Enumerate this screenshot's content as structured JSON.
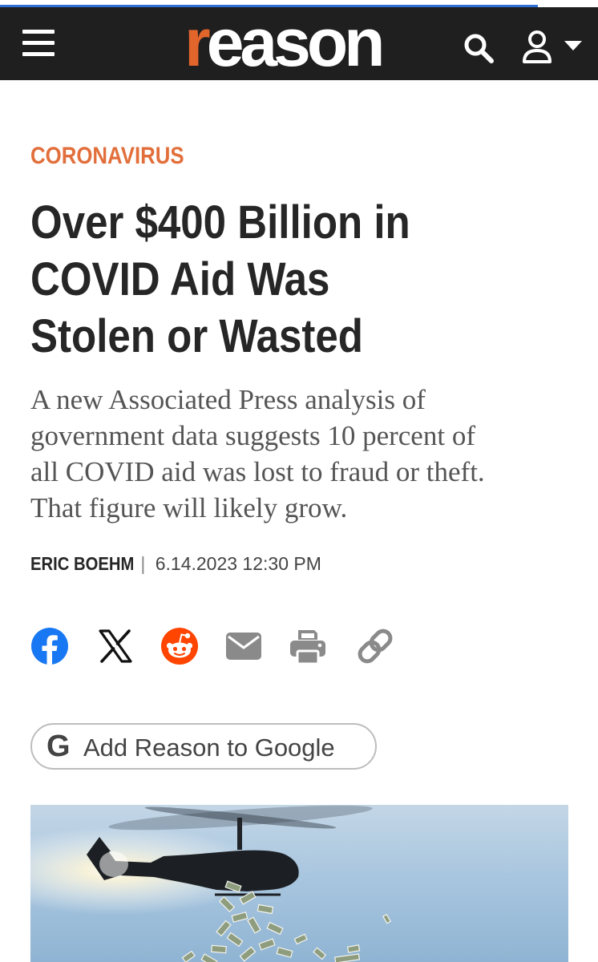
{
  "reading_progress": 0.9,
  "header": {
    "logo_first": "r",
    "logo_rest": "eason",
    "accent": "#e2652c",
    "icons": [
      "menu-icon",
      "search-icon",
      "user-icon",
      "caret-down-icon"
    ]
  },
  "article": {
    "category": "CORONAVIRUS",
    "headline_lines": [
      "Over $400 Billion in",
      "COVID Aid Was",
      "Stolen or Wasted"
    ],
    "dek_lines": [
      "A new Associated Press analysis of",
      "government data suggests 10 percent of",
      "all COVID aid was lost to fraud or theft.",
      "That figure will likely grow."
    ],
    "author": "ERIC BOEHM",
    "separator": "|",
    "date": "6.14.2023 12:30 PM"
  },
  "share": {
    "icons": [
      "facebook-icon",
      "x-icon",
      "reddit-icon",
      "email-icon",
      "print-icon",
      "link-icon"
    ],
    "colors": {
      "facebook": "#1877f2",
      "reddit": "#ff4500",
      "muted": "#8a8a8a",
      "x": "#111111"
    }
  },
  "google_button": {
    "glyph": "G",
    "label": "Add Reason to Google"
  },
  "hero_image": {
    "subject": "helicopter-dropping-money-image"
  }
}
